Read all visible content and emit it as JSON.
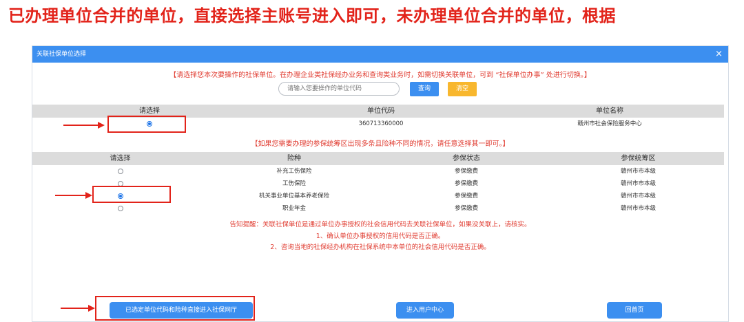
{
  "banner": "已办理单位合并的单位，直接选择主账号进入即可，未办理单位合并的单位，根据",
  "dialog": {
    "title": "关联社保单位选择",
    "close": "×",
    "notice": "【请选择您本次要操作的社保单位。在办理企业类社保经办业务和查询类业务时，如需切换关联单位，可到 “社保单位办事” 处进行切换。】",
    "search": {
      "placeholder": "请输入您要操作的单位代码",
      "query_label": "查询",
      "clear_label": "清空"
    },
    "unit_table": {
      "headers": [
        "请选择",
        "单位代码",
        "单位名称"
      ],
      "rows": [
        {
          "selected": true,
          "code": "360713360000",
          "name": "赣州市社会保险服务中心"
        }
      ]
    },
    "notice2": "【如果您需要办理的参保统筹区出现多条且险种不同的情况，请任意选择其一即可。】",
    "insurance_table": {
      "headers": [
        "请选择",
        "险种",
        "参保状态",
        "参保统筹区"
      ],
      "rows": [
        {
          "selected": false,
          "type": "补充工伤保险",
          "status": "参保缴费",
          "region": "赣州市市本级"
        },
        {
          "selected": false,
          "type": "工伤保险",
          "status": "参保缴费",
          "region": "赣州市市本级"
        },
        {
          "selected": true,
          "type": "机关事业单位基本养老保险",
          "status": "参保缴费",
          "region": "赣州市市本级"
        },
        {
          "selected": false,
          "type": "职业年金",
          "status": "参保缴费",
          "region": "赣州市市本级"
        }
      ]
    },
    "hints": [
      "告知提醒：关联社保单位是通过单位办事授权的社会信用代码去关联社保单位，如果没关联上，请核实。",
      "1、确认单位办事授权的信用代码是否正确。",
      "2、咨询当地的社保经办机构在社保系统中本单位的社会信用代码是否正确。"
    ],
    "buttons": {
      "enter_hall": "已选定单位代码和险种直接进入社保网厅",
      "user_center": "进入用户中心",
      "home": "回首页"
    }
  },
  "colors": {
    "accent": "#3c8ff0",
    "warning": "#f8b72e",
    "annotation": "#e2231a"
  }
}
